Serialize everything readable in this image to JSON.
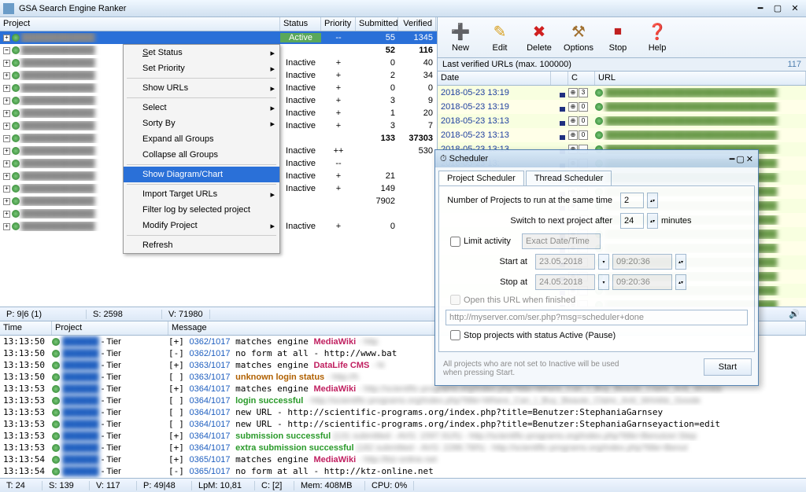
{
  "window": {
    "title": "GSA Search Engine Ranker"
  },
  "project_header": {
    "project": "Project",
    "status": "Status",
    "priority": "Priority",
    "submitted": "Submitted",
    "verified": "Verified"
  },
  "projects": [
    {
      "status": "Active",
      "priority": "--",
      "submitted": "55",
      "verified": "1345",
      "sel": true
    },
    {
      "bold": true,
      "submitted": "52",
      "verified": "116"
    },
    {
      "status": "Inactive",
      "priority": "+",
      "submitted": "0",
      "verified": "40"
    },
    {
      "status": "Inactive",
      "priority": "+",
      "submitted": "2",
      "verified": "34"
    },
    {
      "status": "Inactive",
      "priority": "+",
      "submitted": "0",
      "verified": "0"
    },
    {
      "status": "Inactive",
      "priority": "+",
      "submitted": "3",
      "verified": "9"
    },
    {
      "status": "Inactive",
      "priority": "+",
      "submitted": "1",
      "verified": "20"
    },
    {
      "status": "Inactive",
      "priority": "+",
      "submitted": "3",
      "verified": "7"
    },
    {
      "bold": true,
      "submitted": "133",
      "verified": "37303"
    },
    {
      "status": "Inactive",
      "priority": "++",
      "submitted": "",
      "verified": "530"
    },
    {
      "status": "Inactive",
      "priority": "--",
      "submitted": "",
      "verified": ""
    },
    {
      "status": "Inactive",
      "priority": "+",
      "submitted": "21",
      "verified": ""
    },
    {
      "status": "Inactive",
      "priority": "+",
      "submitted": "149",
      "verified": ""
    },
    {
      "submitted": "7902",
      "verified": ""
    },
    {
      "submitted": "",
      "verified": ""
    },
    {
      "status": "Inactive",
      "priority": "+",
      "submitted": "0",
      "verified": ""
    }
  ],
  "context_menu": {
    "set_status": "Set Status",
    "set_priority": "Set Priority",
    "show_urls": "Show URLs",
    "select": "Select",
    "sort_by": "Sorty By",
    "expand": "Expand all Groups",
    "collapse": "Collapse all Groups",
    "diagram": "Show Diagram/Chart",
    "import": "Import Target URLs",
    "filter": "Filter log by selected project",
    "modify": "Modify Project",
    "refresh": "Refresh"
  },
  "toolbar": {
    "new": "New",
    "edit": "Edit",
    "delete": "Delete",
    "options": "Options",
    "stop": "Stop",
    "help": "Help"
  },
  "urls": {
    "header": "Last verified URLs (max. 100000)",
    "count": "117",
    "cols": {
      "date": "Date",
      "c": "C",
      "url": "URL"
    },
    "rows": [
      {
        "date": "2018-05-23 13:19",
        "c": "3"
      },
      {
        "date": "2018-05-23 13:19",
        "c": "0"
      },
      {
        "date": "2018-05-23 13:13",
        "c": "0"
      },
      {
        "date": "2018-05-23 13:13",
        "c": "0"
      },
      {
        "date": "2018-05-23 13:13",
        "c": ""
      },
      {
        "date": "2018-05-23 13:",
        "c": ""
      },
      {
        "date": "",
        "c": ""
      },
      {
        "date": "",
        "c": ""
      },
      {
        "date": "",
        "c": ""
      },
      {
        "date": "",
        "c": ""
      },
      {
        "date": "",
        "c": ""
      },
      {
        "date": "",
        "c": ""
      },
      {
        "date": "",
        "c": ""
      },
      {
        "date": "",
        "c": ""
      },
      {
        "date": "",
        "c": ""
      },
      {
        "date": "",
        "c": ""
      }
    ]
  },
  "status1": {
    "p": "P: 9|6 (1)",
    "s": "S: 2598",
    "v": "V: 71980"
  },
  "scheduler": {
    "title": "Scheduler",
    "tab1": "Project Scheduler",
    "tab2": "Thread Scheduler",
    "num_label": "Number of Projects to run at the same time",
    "num_val": "2",
    "switch_label": "Switch to next project after",
    "switch_val": "24",
    "minutes": "minutes",
    "limit": "Limit activity",
    "limit_val": "Exact Date/Time",
    "start_at": "Start at",
    "start_date": "23.05.2018",
    "start_time": "09:20:36",
    "stop_at": "Stop at",
    "stop_date": "24.05.2018",
    "stop_time": "09:20:36",
    "open_url": "Open this URL when finished",
    "url_val": "http://myserver.com/ser.php?msg=scheduler+done",
    "stop_active": "Stop projects with status Active (Pause)",
    "note": "All projects who are not set to Inactive will be used when pressing Start.",
    "start_btn": "Start"
  },
  "log": {
    "cols": {
      "time": "Time",
      "project": "Project",
      "message": "Message"
    },
    "rows": [
      {
        "time": "13:13:50",
        "tier": "- Tier",
        "p": "[+]",
        "n": "0362/1017",
        "t": "matches engine",
        "eng": "MediaWiki",
        "rest": " - http"
      },
      {
        "time": "13:13:50",
        "tier": "- Tier",
        "p": "[-]",
        "n": "0362/1017",
        "t": "no form at all - http://www.bat",
        "rest": ""
      },
      {
        "time": "13:13:50",
        "tier": "- Tier",
        "p": "[+]",
        "n": "0363/1017",
        "t": "matches engine",
        "eng": "DataLife CMS",
        "rest": " - ht"
      },
      {
        "time": "13:13:50",
        "tier": "- Tier",
        "p": "[ ]",
        "n": "0363/1017",
        "warn": "unknown login status",
        "rest": " - http://h"
      },
      {
        "time": "13:13:53",
        "tier": "- Tier",
        "p": "[+]",
        "n": "0364/1017",
        "t": "matches engine",
        "eng": "MediaWiki",
        "rest": " - http://scientific-programs.org/index.php?title=Where_Can_I_Buy_Beaute_Claire_Anti_Wrinkle"
      },
      {
        "time": "13:13:53",
        "tier": "- Tier",
        "p": "[ ]",
        "n": "0364/1017",
        "ok": "login successful",
        "rest": " - http://scientific-programs.org/index.php?title=Where_Can_I_Buy_Beaute_Claire_Anti_Wrinkle_Goode"
      },
      {
        "time": "13:13:53",
        "tier": "- Tier",
        "p": "[ ]",
        "n": "0364/1017",
        "t": "new URL - http://scientific-programs.org/index.php?title=Benutzer:StephaniaGarnsey",
        "rest": ""
      },
      {
        "time": "13:13:53",
        "tier": "- Tier",
        "p": "[ ]",
        "n": "0364/1017",
        "t": "new URL - http://scientific-programs.org/index.php?title=Benutzer:StephaniaGarnseyaction=edit",
        "rest": ""
      },
      {
        "time": "13:13:53",
        "tier": "- Tier",
        "p": "[+]",
        "n": "0364/1017",
        "ok": "submission successful",
        "rest": " (131 submitted - AVG: 1597.91/h) - http://scientific-programs.org/index.php?title=Benutzer:Step"
      },
      {
        "time": "13:13:53",
        "tier": "- Tier",
        "p": "[+]",
        "n": "0364/1017",
        "ok": "extra submission successful",
        "rest": " (182 submitted - AVG: 2288.78/h) - http://scientific-programs.org/index.php?title=Benut"
      },
      {
        "time": "13:13:54",
        "tier": "- Tier",
        "p": "[+]",
        "n": "0365/1017",
        "t": "matches engine",
        "eng": "MediaWiki",
        "rest": " - http://ktz-online.net"
      },
      {
        "time": "13:13:54",
        "tier": "- Tier",
        "p": "[-]",
        "n": "0365/1017",
        "t": "no form at all - http://ktz-online.net",
        "rest": ""
      }
    ]
  },
  "status2": {
    "t": "T: 24",
    "s": "S: 139",
    "v": "V: 117",
    "p": "P: 49|48",
    "lpm": "LpM: 10,81",
    "c": "C: [2]",
    "mem": "Mem: 408MB",
    "cpu": "CPU: 0%"
  }
}
